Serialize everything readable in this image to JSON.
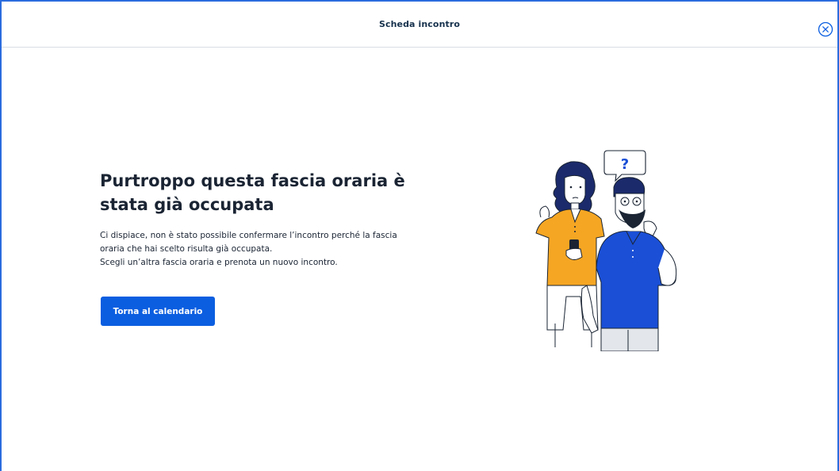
{
  "header": {
    "title": "Scheda incontro",
    "close_icon": "close-circle-icon"
  },
  "main": {
    "title_line1": "Purtroppo questa fascia oraria è",
    "title_line2": "stata già occupata",
    "description_lines": [
      "Ci dispiace, non è stato possibile confermare l’incontro perché la fascia",
      "oraria che hai scelto risulta già occupata.",
      "Scegli un’altra fascia oraria e prenota un nuovo incontro."
    ],
    "cta_label": "Torna al calendario",
    "illustration_text": "?"
  },
  "colors": {
    "accent": "#0b5ee0",
    "frame_border": "#2b6cde",
    "text": "#1a2433",
    "shirt_yellow": "#f5a623",
    "shirt_blue": "#1a4fd6"
  }
}
